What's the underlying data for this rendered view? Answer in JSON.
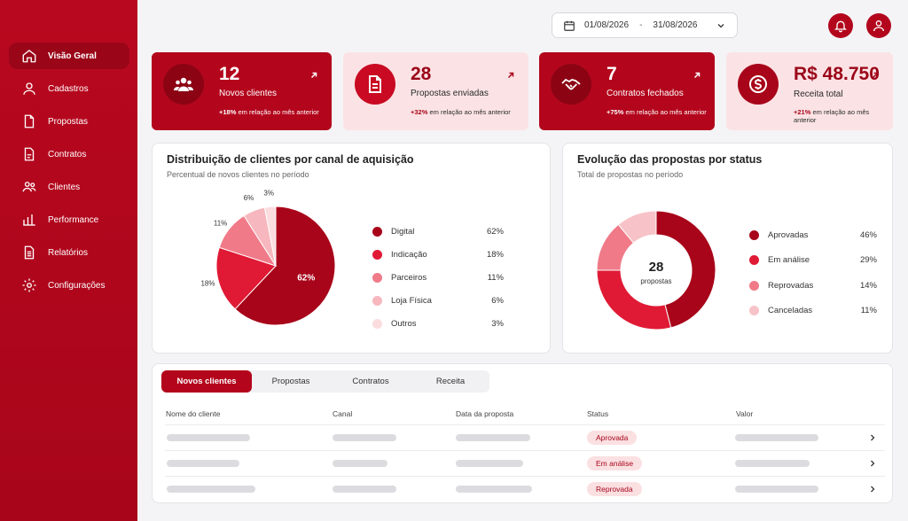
{
  "sidebar": {
    "items": [
      {
        "label": "Visão Geral",
        "icon": "home-icon",
        "active": true
      },
      {
        "label": "Cadastros",
        "icon": "user-icon"
      },
      {
        "label": "Propostas",
        "icon": "document-icon"
      },
      {
        "label": "Contratos",
        "icon": "contract-icon"
      },
      {
        "label": "Clientes",
        "icon": "users-icon"
      },
      {
        "label": "Performance",
        "icon": "bar-chart-icon"
      },
      {
        "label": "Relatórios",
        "icon": "report-icon"
      },
      {
        "label": "Configurações",
        "icon": "gear-icon"
      }
    ]
  },
  "header": {
    "date_from": "01/08/2026",
    "date_sep": "-",
    "date_to": "31/08/2026"
  },
  "kpis": [
    {
      "value": "12",
      "label": "Novos clientes",
      "delta": "+18%",
      "delta_text": "em relação ao mês anterior",
      "icon": "users-icon"
    },
    {
      "value": "28",
      "label": "Propostas enviadas",
      "delta": "+32%",
      "delta_text": "em relação ao mês anterior",
      "icon": "document-icon"
    },
    {
      "value": "7",
      "label": "Contratos fechados",
      "delta": "+75%",
      "delta_text": "em relação ao mês anterior",
      "icon": "handshake-icon"
    },
    {
      "value": "R$ 48.750",
      "label": "Receita total",
      "delta": "+21%",
      "delta_text": "em relação ao mês anterior",
      "icon": "dollar-icon"
    }
  ],
  "chart_data": [
    {
      "type": "pie",
      "title": "Distribuição de clientes por canal de aquisição",
      "subtitle": "Percentual de novos clientes no período",
      "categories": [
        "Digital",
        "Indicação",
        "Parceiros",
        "Loja Física",
        "Outros"
      ],
      "values": [
        62,
        18,
        11,
        6,
        3
      ],
      "labels": [
        "62%",
        "18%",
        "11%",
        "6%",
        "3%"
      ],
      "colors": [
        "#a8051a",
        "#e01a35",
        "#f07a88",
        "#f7b7be",
        "#fbdcdf"
      ],
      "legend": "right"
    },
    {
      "type": "pie",
      "title": "Evolução das propostas por status",
      "subtitle": "Total de propostas no período",
      "categories": [
        "Aprovadas",
        "Em análise",
        "Reprovadas",
        "Canceladas"
      ],
      "values": [
        46,
        29,
        14,
        11
      ],
      "labels": [
        "46%",
        "29%",
        "14%",
        "11%"
      ],
      "colors": [
        "#a8051a",
        "#e01a35",
        "#f07a88",
        "#f7c3c8"
      ],
      "center_value": "28",
      "center_label": "propostas",
      "legend": "right"
    }
  ],
  "table": {
    "tabs": [
      "Novos clientes",
      "Propostas",
      "Contratos",
      "Receita"
    ],
    "active_tab": 0,
    "columns": [
      "Nome do cliente",
      "Canal",
      "Data da proposta",
      "Status",
      "Valor"
    ],
    "rows": [
      {
        "status": "Aprovada"
      },
      {
        "status": "Em análise"
      },
      {
        "status": "Reprovada"
      }
    ]
  }
}
